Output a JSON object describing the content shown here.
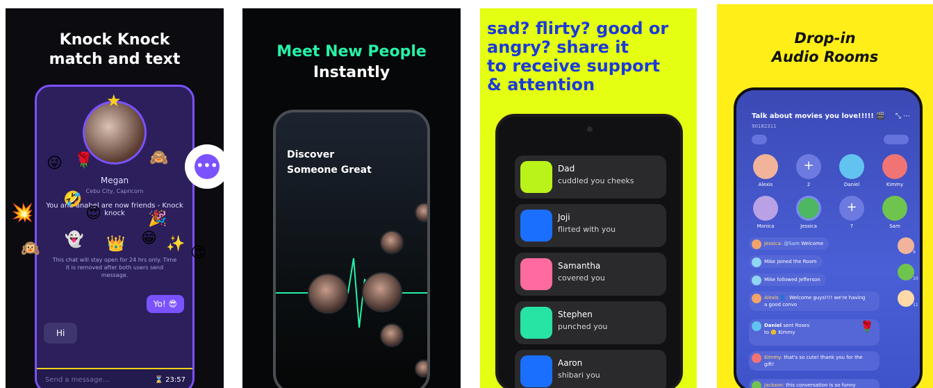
{
  "panel1": {
    "headline_l1": "Knock Knock",
    "headline_l2": "match and text",
    "name": "Megan",
    "location": "Cebu City, Capricorn",
    "friends_l1": "You and anabel are now friends - Knock",
    "friends_l2": "knock",
    "info_l1": "This chat will stay open for 24 hrs only. Time",
    "info_l2": "it is removed after both users send",
    "info_l3": "message.",
    "bubble_sent": "Yo! 😎",
    "bubble_received": "Hi",
    "input_placeholder": "Send a message...",
    "timer": "⌛ 23:57",
    "chat_icon": "chat-bubble-icon"
  },
  "panel2": {
    "headline_l1": "Meet New People",
    "headline_l2": "Instantly",
    "discover_l1": "Discover",
    "discover_l2": "Someone Great",
    "accent_color": "#27f1a8"
  },
  "panel3": {
    "headline_l1": "sad? flirty? good or",
    "headline_l2": "angry? share it",
    "headline_l3": "to receive support",
    "headline_l4": "& attention",
    "cards": [
      {
        "name": "Dad",
        "action": "cuddled you cheeks",
        "color": "#b9f31a"
      },
      {
        "name": "Joji",
        "action": "flirted with you",
        "color": "#1b6fff"
      },
      {
        "name": "Samantha",
        "action": "covered you",
        "color": "#ff6aa0"
      },
      {
        "name": "Stephen",
        "action": "punched you",
        "color": "#27e3a4"
      },
      {
        "name": "Aaron",
        "action": "shibari you",
        "color": "#1b6fff"
      }
    ]
  },
  "panel4": {
    "headline_l1": "Drop-in",
    "headline_l2": "Audio Rooms",
    "room_title": "Talk about movies you love!!!!! 🎬",
    "room_id": "90182311",
    "speakers": [
      {
        "name": "Alexis"
      },
      {
        "name": "2"
      },
      {
        "name": "Daniel"
      },
      {
        "name": "Kimmy"
      },
      {
        "name": "Monica"
      },
      {
        "name": "Jessica"
      },
      {
        "name": "7"
      },
      {
        "name": "Sam"
      }
    ],
    "messages": {
      "m1_user": "Jessica:",
      "m1_mention": "@Sam",
      "m1_text": "Welcome",
      "m2_text": "Mike joined the Room",
      "m3_text": "Mike followed Jefferson",
      "m4_user": "Alexis 👤:",
      "m4_text": "Welcome guys!!!! we're having",
      "m4_text2": "a good convo",
      "m5_user": "Daniel",
      "m5_text": "sent Roses",
      "m5_to": "to 🙂 Kimmy",
      "m6_user": "Kimmy:",
      "m6_text": "that's so cute! thank you for the",
      "m6_text2": "gift!",
      "m7_user": "Jackson:",
      "m7_text": "this conversation is so funny"
    },
    "side_counts": [
      "9",
      "10",
      "11"
    ]
  }
}
